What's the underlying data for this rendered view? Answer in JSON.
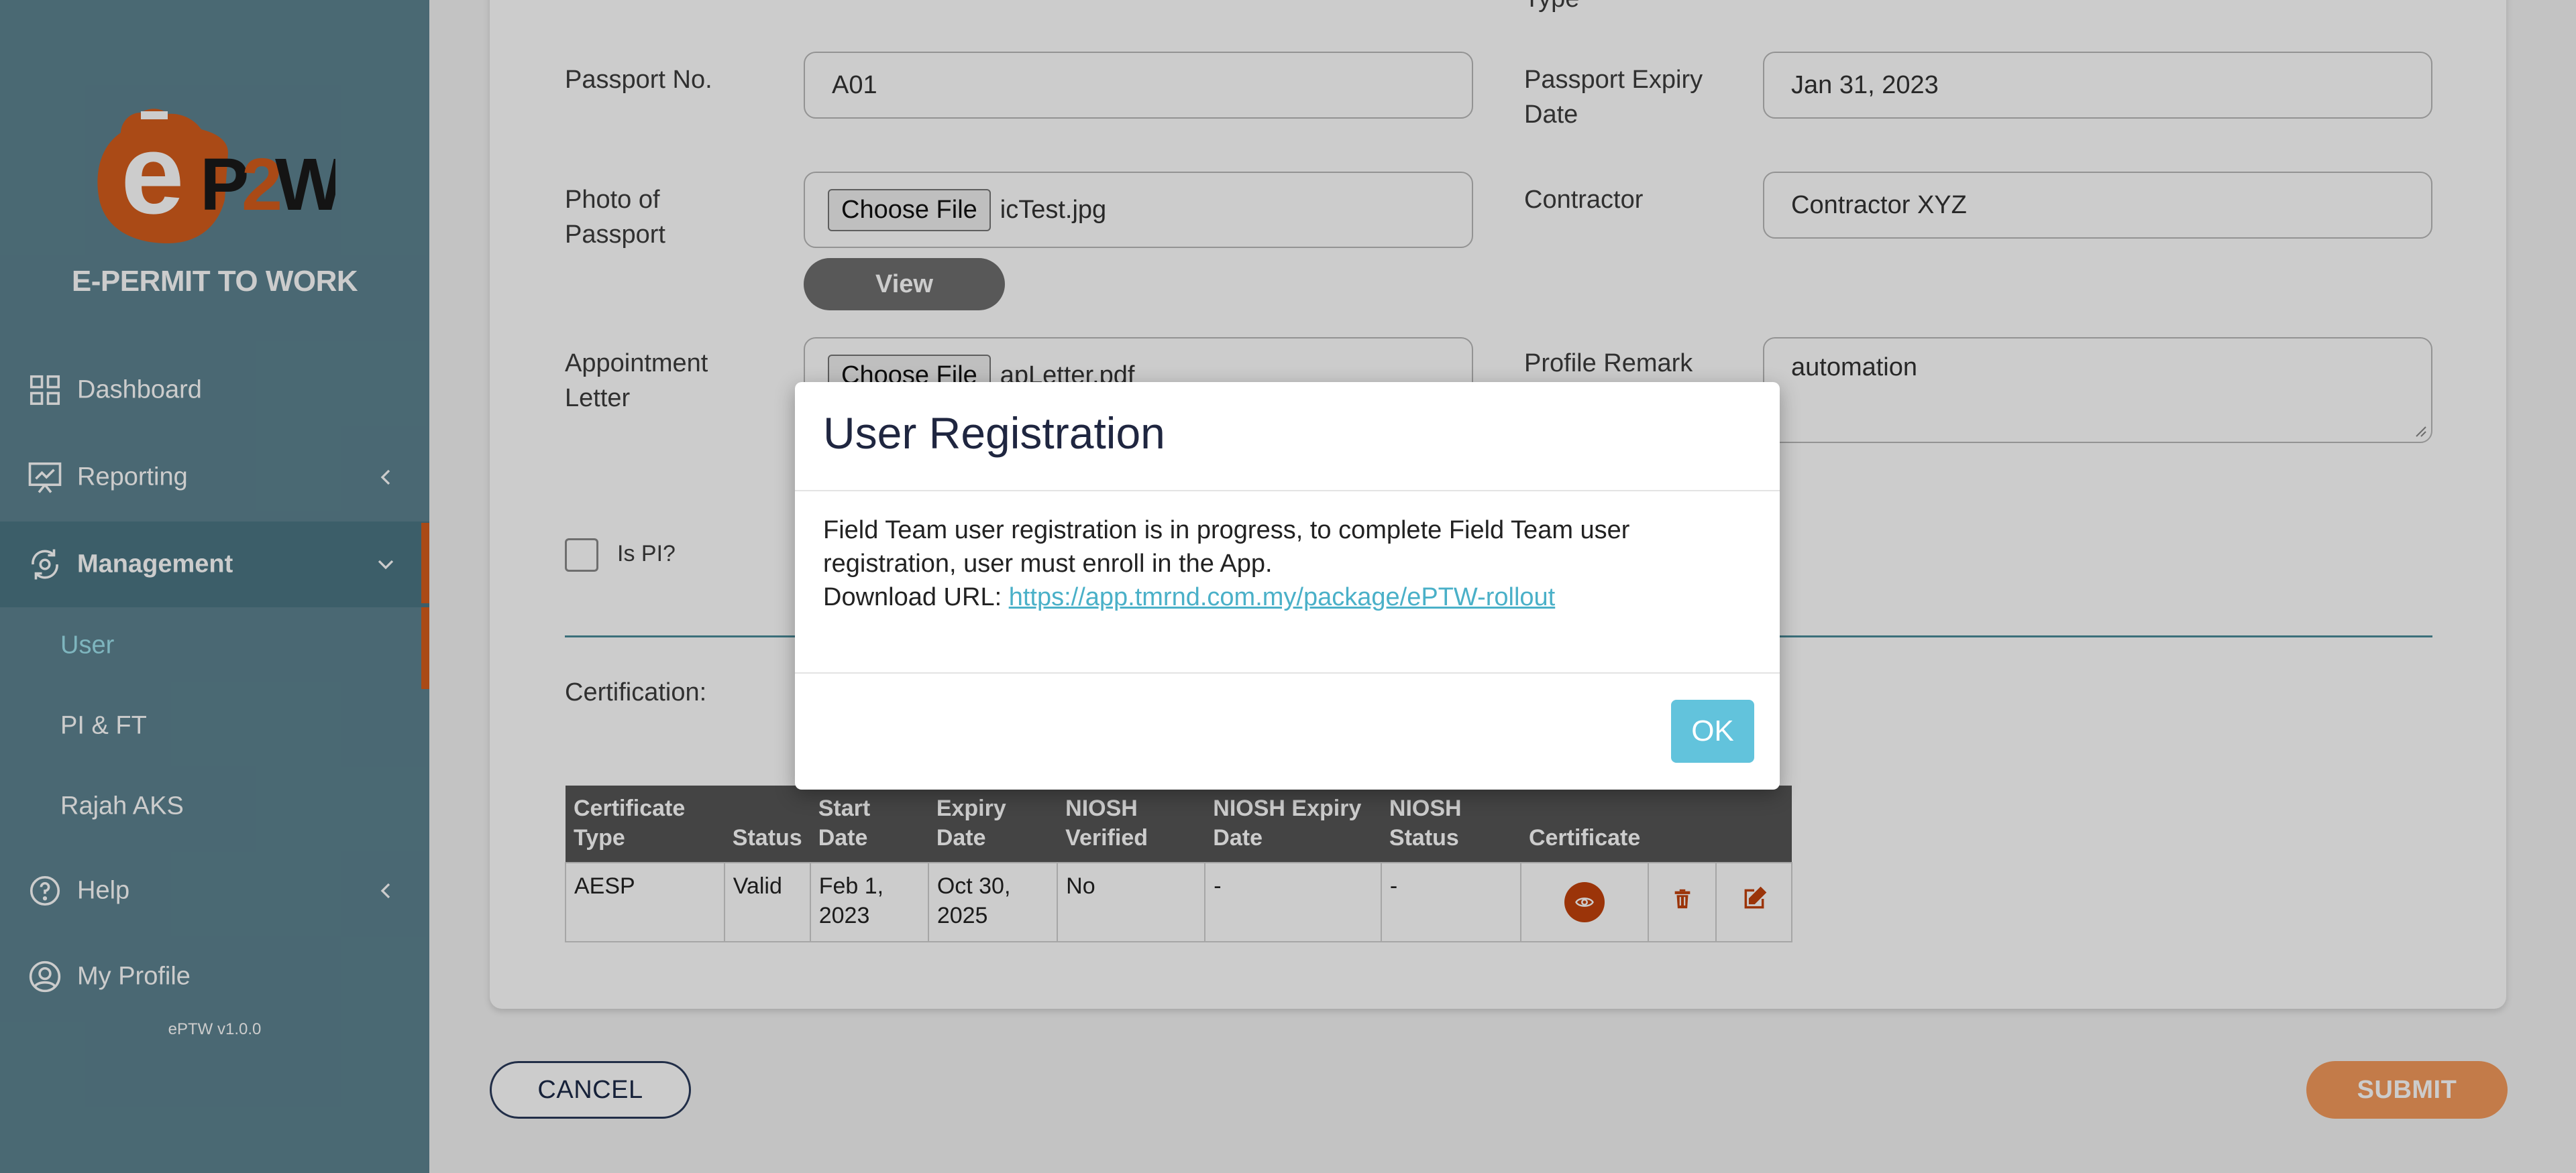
{
  "sidebar": {
    "brand": "E-PERMIT TO WORK",
    "logo_text": "eP2W",
    "version": "ePTW v1.0.0",
    "items": {
      "dashboard": "Dashboard",
      "reporting": "Reporting",
      "management": "Management",
      "help": "Help",
      "my_profile": "My Profile"
    },
    "sub_items": {
      "user": "User",
      "pi_ft": "PI & FT",
      "rajah_aks": "Rajah AKS"
    },
    "colors": {
      "background": "#5d8390",
      "accent": "#d55d1c",
      "active_sub": "#9ee3ee"
    }
  },
  "form": {
    "type_label": "Type",
    "passport_no": {
      "label": "Passport No.",
      "value": "A01"
    },
    "passport_expiry": {
      "label": "Passport Expiry Date",
      "value": "Jan 31, 2023"
    },
    "photo_passport": {
      "label": "Photo of Passport",
      "button": "Choose File",
      "file": "icTest.jpg"
    },
    "view_button": "View",
    "contractor": {
      "label": "Contractor",
      "value": "Contractor XYZ"
    },
    "appointment_letter": {
      "label": "Appointment Letter",
      "button": "Choose File",
      "file": "apLetter.pdf"
    },
    "profile_remark": {
      "label": "Profile Remark",
      "value": "automation"
    },
    "is_pi": {
      "label": "Is PI?",
      "checked": false
    },
    "certification_label": "Certification:"
  },
  "cert_table": {
    "headers": [
      "Certificate Type",
      "Status",
      "Start Date",
      "Expiry Date",
      "NIOSH Verified",
      "NIOSH Expiry Date",
      "NIOSH Status",
      "Certificate",
      "",
      ""
    ],
    "rows": [
      [
        "AESP",
        "Valid",
        "Feb 1, 2023",
        "Oct 30, 2025",
        "No",
        "-",
        "-"
      ]
    ],
    "icons": [
      "eye-icon",
      "trash-icon",
      "edit-icon"
    ]
  },
  "buttons": {
    "cancel": "CANCEL",
    "submit": "SUBMIT"
  },
  "modal": {
    "title": "User Registration",
    "message": "Field Team user registration is in progress, to complete Field Team user registration, user must enroll in the App.",
    "download_label": "Download URL:",
    "download_url": "https://app.tmrnd.com.my/package/ePTW-rollout",
    "ok": "OK"
  }
}
